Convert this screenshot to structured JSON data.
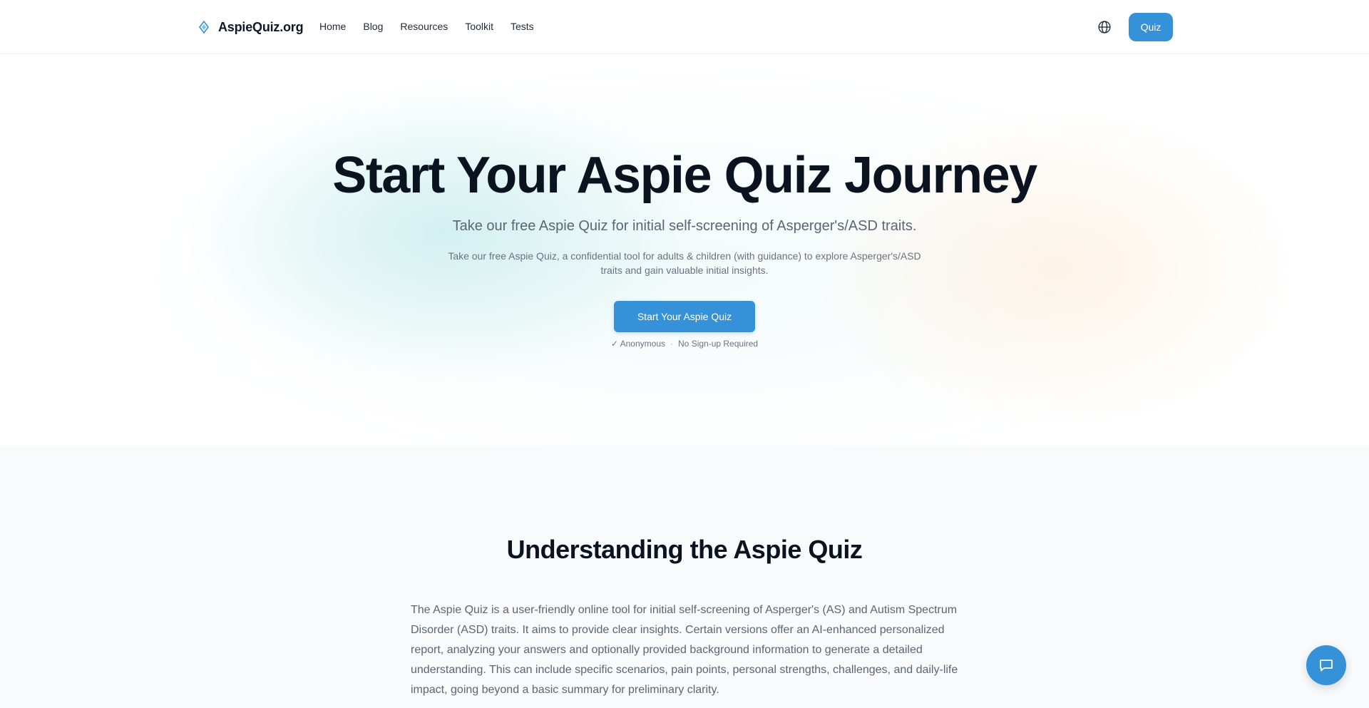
{
  "header": {
    "brand": {
      "name": "AspieQuiz.org",
      "icon": "diamond-logo-icon"
    },
    "nav": [
      "Home",
      "Blog",
      "Resources",
      "Toolkit",
      "Tests"
    ],
    "language_icon": "globe-icon",
    "quiz_button": "Quiz"
  },
  "hero": {
    "title": "Start Your Aspie Quiz Journey",
    "subtitle": "Take our free Aspie Quiz for initial self-screening of Asperger's/ASD traits.",
    "description": "Take our free Aspie Quiz, a confidential tool for adults & children (with guidance) to explore Asperger's/ASD traits and gain valuable initial insights.",
    "cta": "Start Your Aspie Quiz",
    "note_anonymous": "✓ Anonymous",
    "note_separator": "·",
    "note_signup": "No Sign-up Required"
  },
  "about": {
    "title": "Understanding the Aspie Quiz",
    "body": "The Aspie Quiz is a user-friendly online tool for initial self-screening of Asperger's (AS) and Autism Spectrum Disorder (ASD) traits. It aims to provide clear insights. Certain versions offer an AI-enhanced personalized report, analyzing your answers and optionally provided background information to generate a detailed understanding. This can include specific scenarios, pain points, personal strengths, challenges, and daily-life impact, going beyond a basic summary for preliminary clarity."
  },
  "chat": {
    "icon": "chat-bubble-icon"
  },
  "colors": {
    "accent": "#3591d8",
    "heading": "#0b1220",
    "muted_text": "#5b6675",
    "section_bg": "#f8fafc"
  }
}
